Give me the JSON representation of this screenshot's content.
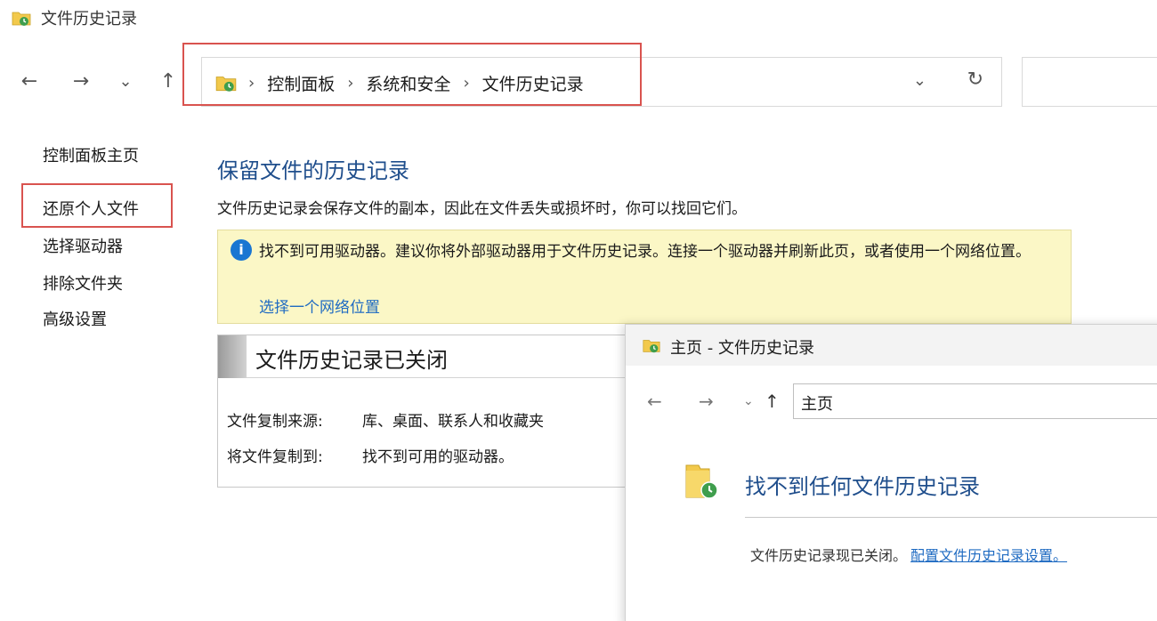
{
  "window": {
    "title": "文件历史记录"
  },
  "nav": {
    "back": "←",
    "forward": "→",
    "recent": "⌄",
    "up": "↑"
  },
  "breadcrumb": [
    "控制面板",
    "系统和安全",
    "文件历史记录"
  ],
  "address_dropdown": "⌄",
  "address_refresh": "↻",
  "sidebar": {
    "items": [
      {
        "label": "控制面板主页"
      },
      {
        "label": "还原个人文件"
      },
      {
        "label": "选择驱动器"
      },
      {
        "label": "排除文件夹"
      },
      {
        "label": "高级设置"
      }
    ]
  },
  "main": {
    "title": "保留文件的历史记录",
    "description": "文件历史记录会保存文件的副本，因此在文件丢失或损坏时，你可以找回它们。",
    "info": {
      "text": "找不到可用驱动器。建议你将外部驱动器用于文件历史记录。连接一个驱动器并刷新此页，或者使用一个网络位置。",
      "link": "选择一个网络位置"
    },
    "status": {
      "title": "文件历史记录已关闭",
      "rows": [
        {
          "label": "文件复制来源:",
          "value": "库、桌面、联系人和收藏夹"
        },
        {
          "label": "将文件复制到:",
          "value": "找不到可用的驱动器。"
        }
      ]
    }
  },
  "dialog": {
    "title": "主页 - 文件历史记录",
    "nav": {
      "back": "←",
      "forward": "→",
      "recent": "⌄",
      "up": "↑"
    },
    "address": "主页",
    "heading": "找不到任何文件历史记录",
    "message": "文件历史记录现已关闭。",
    "link": "配置文件历史记录设置。"
  },
  "colors": {
    "accent_title": "#1f4e8c",
    "link": "#1f6bc2",
    "info_bg": "#fbf7c6",
    "highlight_box": "#d9534f"
  },
  "icons": [
    "file-history-icon",
    "info-icon",
    "back-arrow-icon",
    "forward-arrow-icon",
    "recent-chevron-icon",
    "up-arrow-icon",
    "refresh-icon",
    "folder-history-icon"
  ]
}
